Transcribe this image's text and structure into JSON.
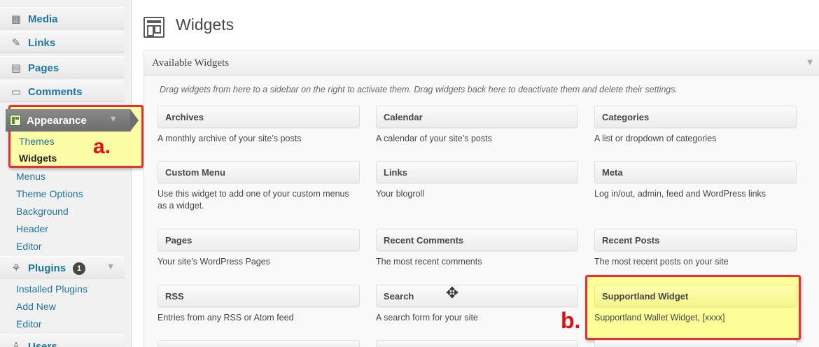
{
  "sidebar": {
    "items": [
      {
        "label": "Media",
        "icon": "media-icon"
      },
      {
        "label": "Links",
        "icon": "link-icon"
      },
      {
        "label": "Pages",
        "icon": "pages-icon"
      },
      {
        "label": "Comments",
        "icon": "comments-icon"
      }
    ],
    "appearance": {
      "label": "Appearance",
      "icon": "appearance-icon",
      "submenu": [
        "Themes",
        "Widgets",
        "Menus",
        "Theme Options",
        "Background",
        "Header",
        "Editor"
      ]
    },
    "plugins": {
      "label": "Plugins",
      "icon": "plugin-icon",
      "badge": "1",
      "submenu": [
        "Installed Plugins",
        "Add New",
        "Editor"
      ]
    },
    "users": {
      "label": "Users",
      "icon": "users-icon"
    }
  },
  "annotations": {
    "a_label": "a.",
    "b_label": "b.",
    "highlight_color": "#e01010"
  },
  "page": {
    "title": "Widgets"
  },
  "panel": {
    "title": "Available Widgets",
    "description": "Drag widgets from here to a sidebar on the right to activate them. Drag widgets back here to deactivate them and delete their settings."
  },
  "widgets": [
    {
      "title": "Archives",
      "desc": "A monthly archive of your site’s posts"
    },
    {
      "title": "Calendar",
      "desc": "A calendar of your site’s posts"
    },
    {
      "title": "Categories",
      "desc": "A list or dropdown of categories"
    },
    {
      "title": "Custom Menu",
      "desc": "Use this widget to add one of your custom menus as a widget."
    },
    {
      "title": "Links",
      "desc": "Your blogroll"
    },
    {
      "title": "Meta",
      "desc": "Log in/out, admin, feed and WordPress links"
    },
    {
      "title": "Pages",
      "desc": "Your site’s WordPress Pages"
    },
    {
      "title": "Recent Comments",
      "desc": "The most recent comments"
    },
    {
      "title": "Recent Posts",
      "desc": "The most recent posts on your site"
    },
    {
      "title": "RSS",
      "desc": "Entries from any RSS or Atom feed"
    },
    {
      "title": "Search",
      "desc": "A search form for your site"
    },
    {
      "title": "Supportland Widget",
      "desc": "Supportland Wallet Widget, [xxxx]"
    }
  ],
  "colors": {
    "link": "#21759b",
    "menu_active": "#6d6d6d",
    "highlight_fill": "#ffff99"
  }
}
